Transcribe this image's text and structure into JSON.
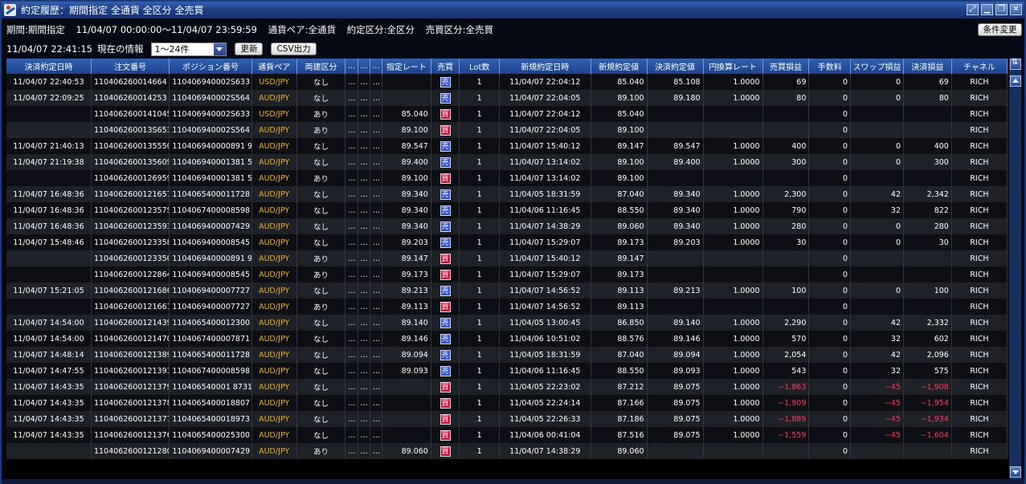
{
  "window": {
    "title": "約定履歴：期間指定 全通貨 全区分 全売買",
    "buttons": [
      "⤢",
      "▁",
      "❐",
      "✕"
    ]
  },
  "filter": {
    "period_label": "期間:期間指定",
    "period_range": "11/04/07 00:00:00〜11/04/07 23:59:59",
    "pair_label": "通貨ペア:全通貨",
    "trade_type_label": "約定区分:全区分",
    "side_label": "売買区分:全売買"
  },
  "toolbar": {
    "change_condition": "条件変更",
    "current_time": "11/04/07 22:41:15",
    "current_info_label": "現在の情報",
    "page_select": "1〜24件",
    "refresh": "更新",
    "csv_export": "CSV出力"
  },
  "table": {
    "columns": [
      "決済約定日時",
      "注文番号",
      "ポジション番号",
      "通貨ペア",
      "両建区分",
      "...",
      "...",
      "...",
      "指定レート",
      "売買",
      "Lot数",
      "新規約定日時",
      "新規約定値",
      "決済約定値",
      "円換算レート",
      "売買損益",
      "手数料",
      "スワップ損益",
      "決済損益",
      "チャネル"
    ],
    "rows": [
      [
        "11/04/07 22:40:53",
        "110406260014664",
        "110406940002S633",
        "USD/JPY",
        "なし",
        "...",
        "...",
        "...",
        "",
        "売",
        "1",
        "11/04/07 22:04:12",
        "85.040",
        "85.108",
        "1.0000",
        "69",
        "0",
        "0",
        "69",
        "RICH"
      ],
      [
        "11/04/07 22:09:25",
        "110406260014253",
        "110406940002S564",
        "AUD/JPY",
        "なし",
        "...",
        "...",
        "...",
        "",
        "売",
        "1",
        "11/04/07 22:04:05",
        "89.100",
        "89.180",
        "1.0000",
        "80",
        "0",
        "0",
        "80",
        "RICH"
      ],
      [
        "",
        "110406260014104S",
        "110406940002S633",
        "USD/JPY",
        "あり",
        "...",
        "...",
        "...",
        "85.040",
        "買",
        "1",
        "11/04/07 22:04:12",
        "85.040",
        "",
        "",
        "",
        "0",
        "",
        "",
        "RICH"
      ],
      [
        "",
        "110406260013S653",
        "110406940002S564",
        "AUD/JPY",
        "あり",
        "...",
        "...",
        "...",
        "89.100",
        "買",
        "1",
        "11/04/07 22:04:05",
        "89.100",
        "",
        "",
        "",
        "0",
        "",
        "",
        "RICH"
      ],
      [
        "11/04/07 21:40:13",
        "1104062600135550",
        "110406940000891 9",
        "AUD/JPY",
        "なし",
        "...",
        "...",
        "...",
        "89.547",
        "売",
        "1",
        "11/04/07 15:40:12",
        "89.147",
        "89.547",
        "1.0000",
        "400",
        "0",
        "0",
        "400",
        "RICH"
      ],
      [
        "11/04/07 21:19:38",
        "1104062600135609",
        "110406940001381 5",
        "AUD/JPY",
        "なし",
        "...",
        "...",
        "...",
        "89.400",
        "売",
        "1",
        "11/04/07 13:14:02",
        "89.100",
        "89.400",
        "1.0000",
        "300",
        "0",
        "0",
        "300",
        "RICH"
      ],
      [
        "",
        "1104062600126959",
        "110406940001381 5",
        "AUD/JPY",
        "あり",
        "...",
        "...",
        "...",
        "89.100",
        "買",
        "1",
        "11/04/07 13:14:02",
        "89.100",
        "",
        "",
        "",
        "0",
        "",
        "",
        "RICH"
      ],
      [
        "11/04/07 16:48:36",
        "1104062600121657",
        "1104065400011728",
        "AUD/JPY",
        "なし",
        "...",
        "...",
        "...",
        "89.340",
        "売",
        "1",
        "11/04/05 18:31:59",
        "87.040",
        "89.340",
        "1.0000",
        "2,300",
        "0",
        "42",
        "2,342",
        "RICH"
      ],
      [
        "11/04/07 16:48:36",
        "110406260012357S",
        "1104067400008598",
        "AUD/JPY",
        "なし",
        "...",
        "...",
        "...",
        "89.340",
        "売",
        "1",
        "11/04/06 11:16:45",
        "88.550",
        "89.340",
        "1.0000",
        "790",
        "0",
        "32",
        "822",
        "RICH"
      ],
      [
        "11/04/07 16:48:36",
        "1104062600123593",
        "1104069400007429",
        "AUD/JPY",
        "なし",
        "...",
        "...",
        "...",
        "89.340",
        "売",
        "1",
        "11/04/07 14:38:29",
        "89.060",
        "89.340",
        "1.0000",
        "280",
        "0",
        "0",
        "280",
        "RICH"
      ],
      [
        "11/04/07 15:48:46",
        "1104062600123358",
        "1104069400008545",
        "AUD/JPY",
        "なし",
        "...",
        "...",
        "...",
        "89.203",
        "売",
        "1",
        "11/04/07 15:29:07",
        "89.173",
        "89.203",
        "1.0000",
        "30",
        "0",
        "0",
        "30",
        "RICH"
      ],
      [
        "",
        "1104062600123350",
        "110406940000891 9",
        "AUD/JPY",
        "あり",
        "...",
        "...",
        "...",
        "89.147",
        "買",
        "1",
        "11/04/07 15:40:12",
        "89.147",
        "",
        "",
        "",
        "0",
        "",
        "",
        "RICH"
      ],
      [
        "",
        "1104062600122864",
        "1104069400008545",
        "AUD/JPY",
        "あり",
        "...",
        "...",
        "...",
        "89.173",
        "買",
        "1",
        "11/04/07 15:29:07",
        "89.173",
        "",
        "",
        "",
        "0",
        "",
        "",
        "RICH"
      ],
      [
        "11/04/07 15:21:05",
        "1104062600121686",
        "1104069400007727",
        "AUD/JPY",
        "なし",
        "...",
        "...",
        "...",
        "89.213",
        "売",
        "1",
        "11/04/07 14:56:52",
        "89.113",
        "89.213",
        "1.0000",
        "100",
        "0",
        "0",
        "100",
        "RICH"
      ],
      [
        "",
        "1104062600121661",
        "1104069400007727",
        "AUD/JPY",
        "あり",
        "...",
        "...",
        "...",
        "89.113",
        "買",
        "1",
        "11/04/07 14:56:52",
        "89.113",
        "",
        "",
        "",
        "0",
        "",
        "",
        "RICH"
      ],
      [
        "11/04/07 14:54:00",
        "1104062600121439",
        "1104065400012300",
        "AUD/JPY",
        "なし",
        "...",
        "...",
        "...",
        "89.140",
        "売",
        "1",
        "11/04/05 13:00:45",
        "86.850",
        "89.140",
        "1.0000",
        "2,290",
        "0",
        "42",
        "2,332",
        "RICH"
      ],
      [
        "11/04/07 14:54:00",
        "1104062600121470",
        "1104067400007871",
        "AUD/JPY",
        "なし",
        "...",
        "...",
        "...",
        "89.146",
        "売",
        "1",
        "11/04/06 10:51:02",
        "88.576",
        "89.146",
        "1.0000",
        "570",
        "0",
        "32",
        "602",
        "RICH"
      ],
      [
        "11/04/07 14:48:14",
        "1104062600121389",
        "1104065400011728",
        "AUD/JPY",
        "なし",
        "...",
        "...",
        "...",
        "89.094",
        "売",
        "1",
        "11/04/05 18:31:59",
        "87.040",
        "89.094",
        "1.0000",
        "2,054",
        "0",
        "42",
        "2,096",
        "RICH"
      ],
      [
        "11/04/07 14:47:55",
        "1104062600121393",
        "1104067400008598",
        "AUD/JPY",
        "なし",
        "...",
        "...",
        "...",
        "89.093",
        "売",
        "1",
        "11/04/06 11:16:45",
        "88.550",
        "89.093",
        "1.0000",
        "543",
        "0",
        "32",
        "575",
        "RICH"
      ],
      [
        "11/04/07 14:43:35",
        "1104062600121379",
        "110406540001 8731",
        "AUD/JPY",
        "なし",
        "...",
        "...",
        "...",
        "",
        "買",
        "1",
        "11/04/05 22:23:02",
        "87.212",
        "89.075",
        "1.0000",
        "−1,863",
        "0",
        "−45",
        "−1,908",
        "RICH"
      ],
      [
        "11/04/07 14:43:35",
        "1104062600121378",
        "1104065400018807",
        "AUD/JPY",
        "なし",
        "...",
        "...",
        "...",
        "",
        "買",
        "1",
        "11/04/05 22:24:14",
        "87.166",
        "89.075",
        "1.0000",
        "−1,909",
        "0",
        "−45",
        "−1,954",
        "RICH"
      ],
      [
        "11/04/07 14:43:35",
        "1104062600121377",
        "1104065400018973",
        "AUD/JPY",
        "なし",
        "...",
        "...",
        "...",
        "",
        "買",
        "1",
        "11/04/05 22:26:33",
        "87.186",
        "89.075",
        "1.0000",
        "−1,889",
        "0",
        "−45",
        "−1,934",
        "RICH"
      ],
      [
        "11/04/07 14:43:35",
        "1104062600121376",
        "1104065400025300",
        "AUD/JPY",
        "なし",
        "...",
        "...",
        "...",
        "",
        "買",
        "1",
        "11/04/06 00:41:04",
        "87.516",
        "89.075",
        "1.0000",
        "−1,559",
        "0",
        "−45",
        "−1,604",
        "RICH"
      ],
      [
        "",
        "1104062600121280",
        "1104069400007429",
        "AUD/JPY",
        "あり",
        "...",
        "...",
        "...",
        "89.060",
        "買",
        "1",
        "11/04/07 14:38:29",
        "89.060",
        "",
        "",
        "",
        "0",
        "",
        "",
        "RICH"
      ]
    ]
  },
  "colors": {
    "pair": "#f0b020",
    "negative": "#ff3a5a",
    "sell_badge": "#2a4fd0",
    "buy_badge": "#c8153a",
    "header": "#2454a6"
  }
}
